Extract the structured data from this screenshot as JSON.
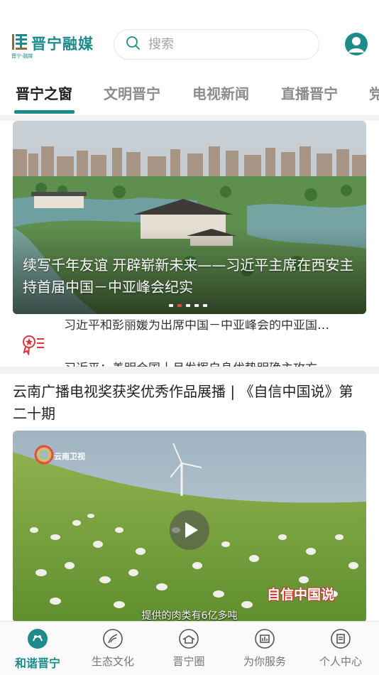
{
  "header": {
    "logo_text": "晋宁融媒",
    "logo_sub": "晋宁·融媒",
    "search_placeholder": "搜索"
  },
  "tabs": [
    {
      "label": "晋宁之窗",
      "active": true
    },
    {
      "label": "文明晋宁",
      "active": false
    },
    {
      "label": "电视新闻",
      "active": false
    },
    {
      "label": "直播晋宁",
      "active": false
    },
    {
      "label": "党",
      "active": false
    }
  ],
  "carousel": {
    "caption": "续写千年友谊 开辟崭新未来——习近平主席在西安主持首届中国－中亚峰会纪实",
    "dot_count": 5,
    "active_dot": 1
  },
  "ticker": {
    "lines": [
      "习近平和彭丽媛为出席中国－中亚峰会的中亚国…",
      "习近平：善明合国十月发挥自身优势明确主攻方"
    ]
  },
  "article": {
    "title": "云南广播电视奖获奖优秀作品展播 | 《自信中国说》第二十期",
    "video_channel": "云南卫视",
    "video_brand": "自信中国说",
    "video_subtitle": "提供的肉类有6亿多吨"
  },
  "bottom_nav": [
    {
      "label": "和谐晋宁",
      "icon": "harmony-icon",
      "active": true
    },
    {
      "label": "生态文化",
      "icon": "ecology-icon",
      "active": false
    },
    {
      "label": "晋宁圈",
      "icon": "circle-icon",
      "active": false
    },
    {
      "label": "为你服务",
      "icon": "service-icon",
      "active": false
    },
    {
      "label": "个人中心",
      "icon": "profile-icon",
      "active": false
    }
  ],
  "colors": {
    "accent": "#1f8a8a",
    "active_dot": "#e64a3b",
    "ticker_icon": "#d9363e"
  }
}
